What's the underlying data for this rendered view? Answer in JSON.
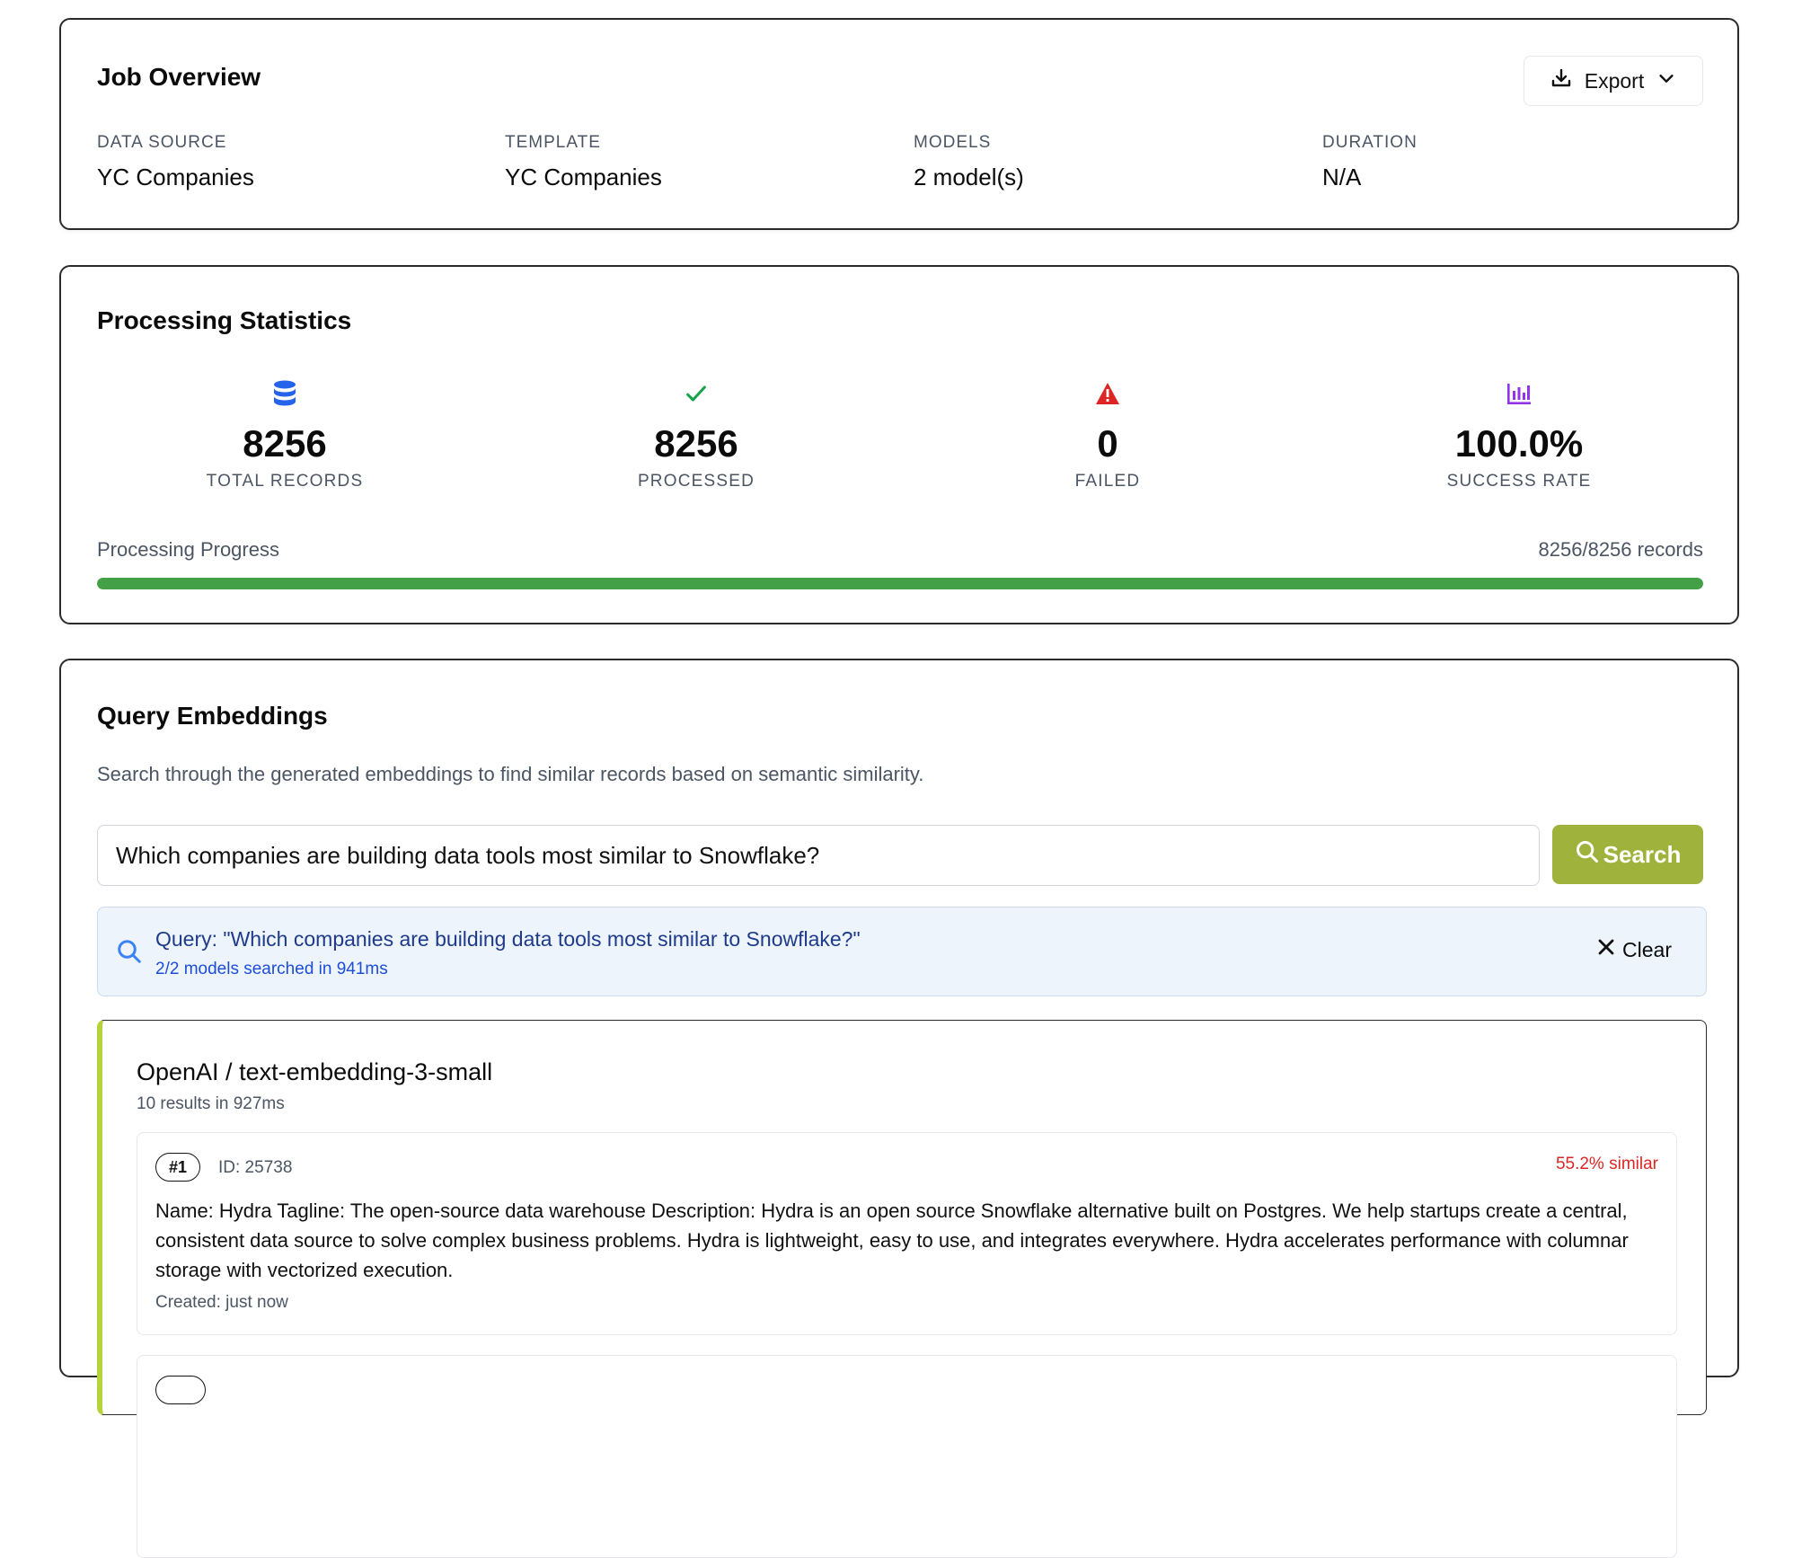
{
  "job_overview": {
    "title": "Job Overview",
    "export_label": "Export",
    "fields": [
      {
        "label": "DATA SOURCE",
        "value": "YC Companies"
      },
      {
        "label": "TEMPLATE",
        "value": "YC Companies"
      },
      {
        "label": "MODELS",
        "value": "2 model(s)"
      },
      {
        "label": "DURATION",
        "value": "N/A"
      }
    ]
  },
  "stats": {
    "title": "Processing Statistics",
    "items": [
      {
        "icon": "database-icon",
        "value": "8256",
        "label": "TOTAL RECORDS",
        "color": "#2563eb"
      },
      {
        "icon": "check-icon",
        "value": "8256",
        "label": "PROCESSED",
        "color": "#16a34a"
      },
      {
        "icon": "warning-icon",
        "value": "0",
        "label": "FAILED",
        "color": "#dc2626"
      },
      {
        "icon": "bar-chart-icon",
        "value": "100.0%",
        "label": "SUCCESS RATE",
        "color": "#9333ea"
      }
    ],
    "progress_label": "Processing Progress",
    "progress_count": "8256/8256 records",
    "progress_fraction": 1.0,
    "progress_color": "#43a047"
  },
  "query": {
    "title": "Query Embeddings",
    "description": "Search through the generated embeddings to find similar records based on semantic similarity.",
    "input_value": "Which companies are building data tools most similar to Snowflake?",
    "search_label": "Search",
    "summary_text": "Query: \"Which companies are building data tools most similar to Snowflake?\"",
    "summary_sub": "2/2 models searched in 941ms",
    "clear_label": "Clear",
    "accent_color": "#9fb33c"
  },
  "model_results": [
    {
      "title": "OpenAI / text-embedding-3-small",
      "subtitle": "10 results in 927ms",
      "results": [
        {
          "rank": "#1",
          "id": "ID: 25738",
          "similarity": "55.2% similar",
          "text": "Name: Hydra Tagline: The open-source data warehouse Description: Hydra is an open source Snowflake alternative built on Postgres. We help startups create a central, consistent data source to solve complex business problems. Hydra is lightweight, easy to use, and integrates everywhere. Hydra accelerates performance with columnar storage with vectorized execution.",
          "created": "Created: just now"
        }
      ]
    }
  ]
}
